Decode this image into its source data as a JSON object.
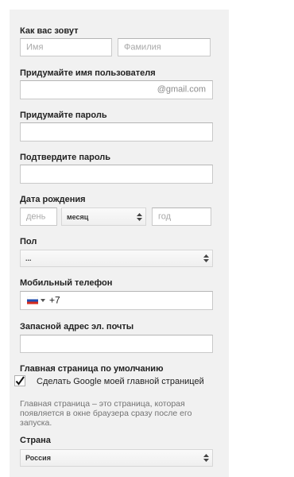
{
  "name": {
    "label": "Как вас зовут",
    "first_placeholder": "Имя",
    "last_placeholder": "Фамилия"
  },
  "username": {
    "label": "Придумайте имя пользователя",
    "value": "",
    "suffix": "@gmail.com"
  },
  "password": {
    "label": "Придумайте пароль",
    "value": ""
  },
  "confirm_password": {
    "label": "Подтвердите пароль",
    "value": ""
  },
  "birthday": {
    "label": "Дата рождения",
    "day_placeholder": "день",
    "month_value": "месяц",
    "year_placeholder": "год"
  },
  "gender": {
    "label": "Пол",
    "value": "..."
  },
  "phone": {
    "label": "Мобильный телефон",
    "country_flag": "russia-flag-icon",
    "value": "+7"
  },
  "backup_email": {
    "label": "Запасной адрес эл. почты",
    "value": ""
  },
  "homepage": {
    "label": "Главная страница по умолчанию",
    "checkbox_label": "Сделать Google моей главной страницей",
    "checked": true,
    "hint": "Главная страница – это страница, которая появляется в окне браузера сразу после его запуска."
  },
  "country": {
    "label": "Страна",
    "value": "Россия"
  },
  "colors": {
    "panel_bg": "#f1f1f1",
    "field_border": "#c9c9c9",
    "placeholder": "#a9a9a9",
    "hint_text": "#737373"
  }
}
